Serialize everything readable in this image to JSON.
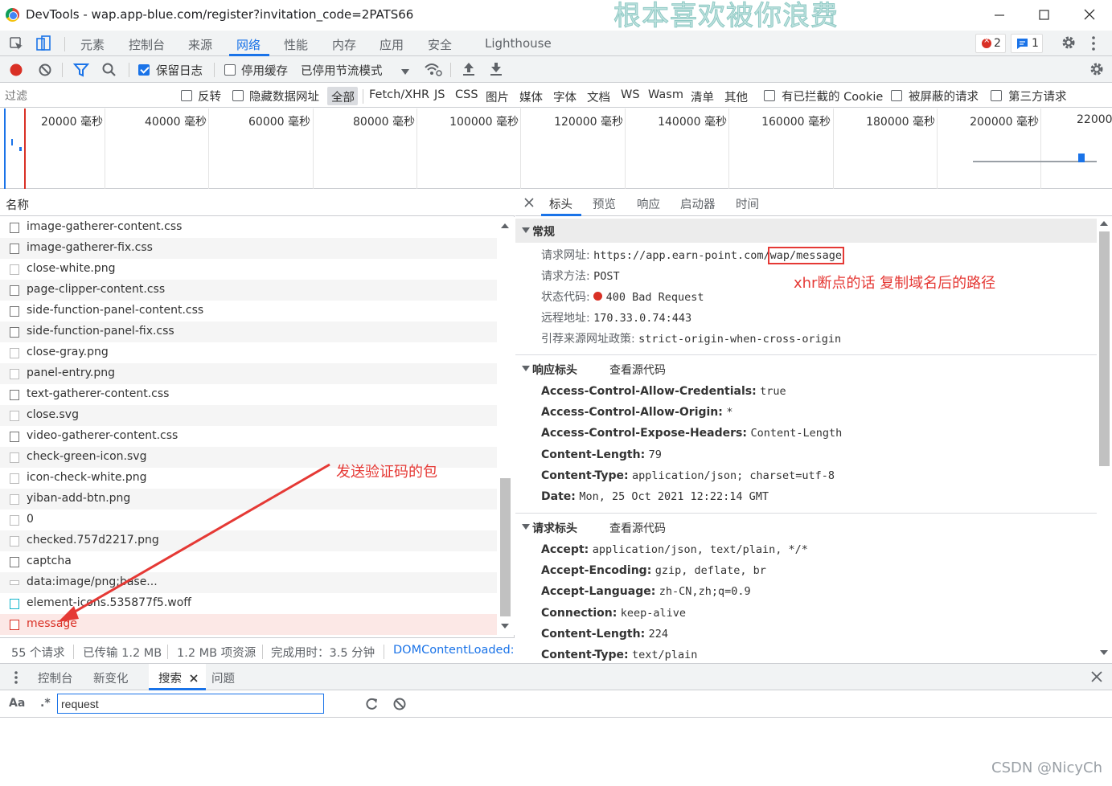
{
  "window": {
    "title": "DevTools - wap.app-blue.com/register?invitation_code=2PATS66",
    "watermark_overlay": "根本喜欢被你浪费"
  },
  "main_tabs": [
    "元素",
    "控制台",
    "来源",
    "网络",
    "性能",
    "内存",
    "应用",
    "安全",
    "Lighthouse"
  ],
  "badges": {
    "errors": "2",
    "messages": "1"
  },
  "toolbar": {
    "preserve_log": "保留日志",
    "disable_cache": "停用缓存",
    "throttling": "已停用节流模式"
  },
  "filter": {
    "placeholder": "过滤",
    "invert": "反转",
    "hide_data_urls": "隐藏数据网址",
    "types": [
      "全部",
      "Fetch/XHR",
      "JS",
      "CSS",
      "图片",
      "媒体",
      "字体",
      "文档",
      "WS",
      "Wasm",
      "清单",
      "其他"
    ],
    "blocked_cookies": "有已拦截的 Cookie",
    "blocked_requests": "被屏蔽的请求",
    "third_party": "第三方请求"
  },
  "timeline": {
    "ticks": [
      "20000 毫秒",
      "40000 毫秒",
      "60000 毫秒",
      "80000 毫秒",
      "100000 毫秒",
      "120000 毫秒",
      "140000 毫秒",
      "160000 毫秒",
      "180000 毫秒",
      "200000 毫秒",
      "22000"
    ]
  },
  "request_list": {
    "header": "名称",
    "rows": [
      {
        "name": "image-gatherer-content.css",
        "icon": "file-icon",
        "status": "ok"
      },
      {
        "name": "image-gatherer-fix.css",
        "icon": "file-icon",
        "status": "ok"
      },
      {
        "name": "close-white.png",
        "icon": "image-icon",
        "status": "ok"
      },
      {
        "name": "page-clipper-content.css",
        "icon": "file-icon",
        "status": "ok"
      },
      {
        "name": "side-function-panel-content.css",
        "icon": "file-icon",
        "status": "ok"
      },
      {
        "name": "side-function-panel-fix.css",
        "icon": "file-icon",
        "status": "ok"
      },
      {
        "name": "close-gray.png",
        "icon": "image-icon",
        "status": "ok"
      },
      {
        "name": "panel-entry.png",
        "icon": "image-icon",
        "status": "ok"
      },
      {
        "name": "text-gatherer-content.css",
        "icon": "file-icon",
        "status": "ok"
      },
      {
        "name": "close.svg",
        "icon": "image-icon",
        "status": "ok"
      },
      {
        "name": "video-gatherer-content.css",
        "icon": "file-icon",
        "status": "ok"
      },
      {
        "name": "check-green-icon.svg",
        "icon": "image-icon",
        "status": "ok"
      },
      {
        "name": "icon-check-white.png",
        "icon": "image-icon",
        "status": "ok"
      },
      {
        "name": "yiban-add-btn.png",
        "icon": "image-icon",
        "status": "ok"
      },
      {
        "name": "0",
        "icon": "image-icon",
        "status": "ok"
      },
      {
        "name": "checked.757d2217.png",
        "icon": "image-icon",
        "status": "ok"
      },
      {
        "name": "captcha",
        "icon": "file-icon",
        "status": "ok"
      },
      {
        "name": "data:image/png;base...",
        "icon": "data-icon",
        "status": "ok"
      },
      {
        "name": "element-icons.535877f5.woff",
        "icon": "font-icon",
        "status": "ok"
      },
      {
        "name": "message",
        "icon": "file-icon",
        "status": "error"
      }
    ]
  },
  "status_bar": {
    "requests": "55 个请求",
    "transferred": "已传输 1.2 MB",
    "resources": "1.2 MB 项资源",
    "finish": "完成用时：3.5 分钟",
    "dom_loaded": "DOMContentLoaded:"
  },
  "detail_tabs": [
    "标头",
    "预览",
    "响应",
    "启动器",
    "时间"
  ],
  "general": {
    "title": "常规",
    "rows": [
      {
        "key": "请求网址:",
        "value_prefix": "https://app.earn-point.com/",
        "value_highlight": "wap/message"
      },
      {
        "key": "请求方法:",
        "value": "POST"
      },
      {
        "key": "状态代码:",
        "value": "400 Bad Request"
      },
      {
        "key": "远程地址:",
        "value": "170.33.0.74:443"
      },
      {
        "key": "引荐来源网址政策:",
        "value": "strict-origin-when-cross-origin"
      }
    ]
  },
  "response_headers": {
    "title": "响应标头",
    "view_source": "查看源代码",
    "rows": [
      {
        "key": "Access-Control-Allow-Credentials:",
        "value": "true"
      },
      {
        "key": "Access-Control-Allow-Origin:",
        "value": "*"
      },
      {
        "key": "Access-Control-Expose-Headers:",
        "value": "Content-Length"
      },
      {
        "key": "Content-Length:",
        "value": "79"
      },
      {
        "key": "Content-Type:",
        "value": "application/json; charset=utf-8"
      },
      {
        "key": "Date:",
        "value": "Mon, 25 Oct 2021 12:22:14 GMT"
      }
    ]
  },
  "request_headers": {
    "title": "请求标头",
    "view_source": "查看源代码",
    "rows": [
      {
        "key": "Accept:",
        "value": "application/json, text/plain, */*"
      },
      {
        "key": "Accept-Encoding:",
        "value": "gzip, deflate, br"
      },
      {
        "key": "Accept-Language:",
        "value": "zh-CN,zh;q=0.9"
      },
      {
        "key": "Connection:",
        "value": "keep-alive"
      },
      {
        "key": "Content-Length:",
        "value": "224"
      },
      {
        "key": "Content-Type:",
        "value": "text/plain"
      }
    ]
  },
  "annotations": {
    "xhr_note": "xhr断点的话  复制域名后的路径",
    "packet_note": "发送验证码的包"
  },
  "drawer": {
    "tabs": [
      "控制台",
      "新变化",
      "搜索",
      "问题"
    ],
    "active_tab": "搜索",
    "case_label": "Aa",
    "regex_label": ".*",
    "search_value": "request"
  },
  "footer_watermark": "CSDN @NicyCh",
  "colors": {
    "accent": "#1a73e8",
    "error": "#d93025",
    "annotation_red": "#e53935",
    "error_row_bg": "#fce8e6"
  }
}
